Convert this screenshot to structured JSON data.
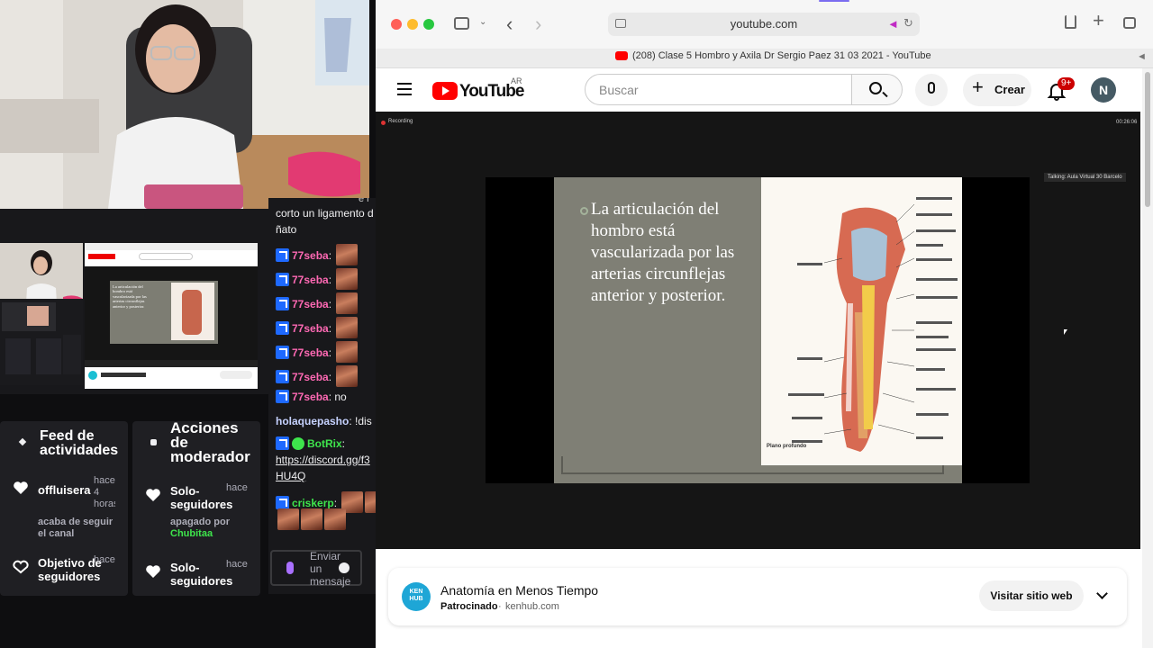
{
  "browser": {
    "url": "youtube.com",
    "tab_title": "(208) Clase 5 Hombro y Axila Dr Sergio Paez 31 03 2021 - YouTube"
  },
  "youtube": {
    "logo_text": "YouTube",
    "region": "AR",
    "search_placeholder": "Buscar",
    "create_label": "Crear",
    "notif_count": "9+",
    "avatar_letter": "N"
  },
  "video": {
    "recording_label": "Recording",
    "timer": "00:26:06",
    "talking_label": "Talking: Aula Virtual 30 Barcelo",
    "slide_text": "La articulación del hombro está vascularizada por las arterias circunflejas anterior y posterior.",
    "figure_caption": "Plano profundo"
  },
  "ad": {
    "logo_text": "KEN HUB",
    "title": "Anatomía en Menos Tiempo",
    "sponsored": "Patrocinado",
    "domain": "kenhub.com",
    "cta": "Visitar sitio web"
  },
  "feed": {
    "title": "Feed de actividades",
    "items": [
      {
        "name": "offluisera",
        "time": "hace 4 horas",
        "desc": "acaba de seguir el canal"
      },
      {
        "name": "Objetivo de seguidores",
        "time": "hace",
        "desc": ""
      }
    ]
  },
  "moderator": {
    "title": "Acciones de moderador",
    "items": [
      {
        "name": "Solo-seguidores",
        "time": "hace",
        "desc_prefix": "apagado por",
        "desc_user": "Chubitaa"
      },
      {
        "name": "Solo-seguidores",
        "time": "hace",
        "desc_prefix": "",
        "desc_user": ""
      }
    ]
  },
  "chat": {
    "top_partial": "e l",
    "intro_line1": "corto un ligamento d",
    "intro_line2": "ñato",
    "messages": [
      {
        "user": "77seba",
        "text": ""
      },
      {
        "user": "77seba",
        "text": ""
      },
      {
        "user": "77seba",
        "text": ""
      },
      {
        "user": "77seba",
        "text": ""
      },
      {
        "user": "77seba",
        "text": ""
      },
      {
        "user": "77seba",
        "text": ""
      },
      {
        "user": "77seba",
        "text": "no"
      }
    ],
    "holaque_user": "holaquepasho",
    "holaque_text": "!dis",
    "botrix_user": "BotRix",
    "botrix_link1": "https://discord.gg/f3",
    "botrix_link2": "HU4Q",
    "crisk_user": "criskerp",
    "input_placeholder": "Enviar un mensaje"
  },
  "preview": {
    "slide_text": "La articulación del hombro está vascularizada por las arterias circunflejas anterior y posterior."
  },
  "colors": {
    "youtube_red": "#ff0000",
    "twitch_blue": "#1e69ff",
    "chat_pink": "#ff69b4",
    "chat_green": "#3ee54c",
    "moderator_green": "#3ee54c"
  }
}
